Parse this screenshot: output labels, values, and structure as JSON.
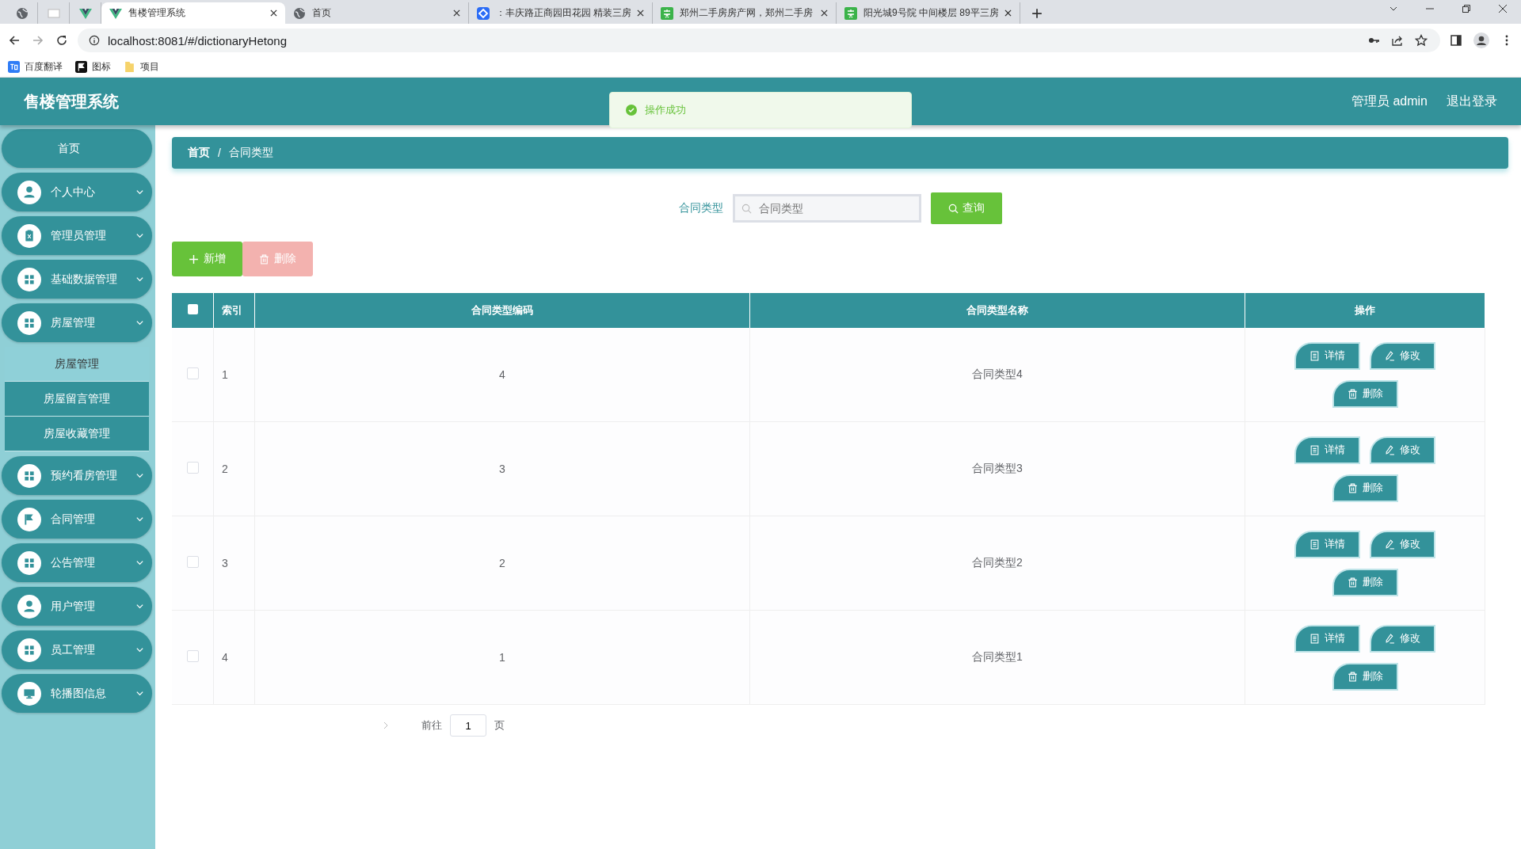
{
  "browser": {
    "tabs": [
      {
        "kind": "globe",
        "selected": false
      },
      {
        "kind": "blank",
        "selected": false
      },
      {
        "kind": "vue",
        "selected": false
      },
      {
        "kind": "vue",
        "title": "售楼管理系统",
        "selected": true
      },
      {
        "kind": "globe",
        "title": "首页",
        "selected": false
      },
      {
        "kind": "blue",
        "title": "：丰庆路正商园田花园 精装三房",
        "selected": false
      },
      {
        "kind": "green",
        "title": "郑州二手房房产网，郑州二手房",
        "selected": false
      },
      {
        "kind": "green",
        "title": "阳光城9号院 中间楼层 89平三房",
        "selected": false
      }
    ],
    "url": "localhost:8081/#/dictionaryHetong",
    "bookmarks": [
      {
        "kind": "translate",
        "label": "百度翻译"
      },
      {
        "kind": "flag",
        "label": "图标"
      },
      {
        "kind": "folder",
        "label": "项目"
      }
    ]
  },
  "app": {
    "title": "售楼管理系统",
    "toast": "操作成功",
    "user": "管理员 admin",
    "logout": "退出登录",
    "sidebar": [
      {
        "label": "首页",
        "kind": "plain"
      },
      {
        "label": "个人中心",
        "kind": "person"
      },
      {
        "label": "管理员管理",
        "kind": "clipboard"
      },
      {
        "label": "基础数据管理",
        "kind": "grid"
      },
      {
        "label": "房屋管理",
        "kind": "grid",
        "children": [
          {
            "label": "房屋管理",
            "selected": true
          },
          {
            "label": "房屋留言管理",
            "selected": false
          },
          {
            "label": "房屋收藏管理",
            "selected": false
          }
        ]
      },
      {
        "label": "预约看房管理",
        "kind": "grid"
      },
      {
        "label": "合同管理",
        "kind": "flag"
      },
      {
        "label": "公告管理",
        "kind": "grid"
      },
      {
        "label": "用户管理",
        "kind": "person"
      },
      {
        "label": "员工管理",
        "kind": "grid"
      },
      {
        "label": "轮播图信息",
        "kind": "monitor"
      }
    ],
    "breadcrumb": [
      "首页",
      "/",
      "合同类型"
    ],
    "search": {
      "label": "合同类型",
      "placeholder": "合同类型",
      "button": "查询"
    },
    "actions": [
      {
        "label": "新增",
        "kind": "add",
        "disabled": false
      },
      {
        "label": "删除",
        "kind": "delete",
        "disabled": true
      }
    ],
    "table": {
      "header_checked": false,
      "columns": [
        "索引",
        "合同类型编码",
        "合同类型名称",
        "操作"
      ],
      "rows": [
        {
          "checked": false,
          "cells": [
            "1",
            "4",
            "合同类型4"
          ],
          "actions": [
            {
              "kind": "detail",
              "label": "详情"
            },
            {
              "kind": "edit",
              "label": "修改"
            },
            {
              "kind": "delete",
              "label": "删除"
            }
          ]
        },
        {
          "checked": false,
          "cells": [
            "2",
            "3",
            "合同类型3"
          ],
          "actions": [
            {
              "kind": "detail",
              "label": "详情"
            },
            {
              "kind": "edit",
              "label": "修改"
            },
            {
              "kind": "delete",
              "label": "删除"
            }
          ]
        },
        {
          "checked": false,
          "cells": [
            "3",
            "2",
            "合同类型2"
          ],
          "actions": [
            {
              "kind": "detail",
              "label": "详情"
            },
            {
              "kind": "edit",
              "label": "修改"
            },
            {
              "kind": "delete",
              "label": "删除"
            }
          ]
        },
        {
          "checked": false,
          "cells": [
            "4",
            "1",
            "合同类型1"
          ],
          "actions": [
            {
              "kind": "detail",
              "label": "详情"
            },
            {
              "kind": "edit",
              "label": "修改"
            },
            {
              "kind": "delete",
              "label": "删除"
            }
          ]
        }
      ]
    },
    "pagination": {
      "goto": "前往",
      "page": "1",
      "suffix": "页"
    }
  }
}
